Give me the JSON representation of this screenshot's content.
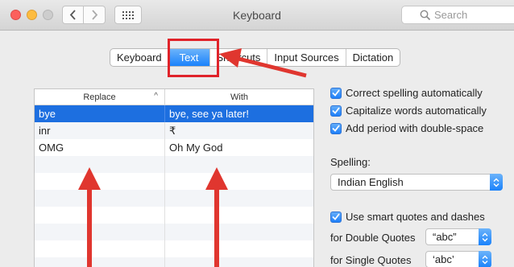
{
  "window": {
    "title": "Keyboard",
    "search_placeholder": "Search"
  },
  "tabs": [
    {
      "label": "Keyboard"
    },
    {
      "label": "Text"
    },
    {
      "label": "Shortcuts"
    },
    {
      "label": "Input Sources"
    },
    {
      "label": "Dictation"
    }
  ],
  "table": {
    "col_replace": "Replace",
    "col_with": "With",
    "rows": [
      {
        "replace": "bye",
        "with": "bye, see ya later!"
      },
      {
        "replace": "inr",
        "with": "₹"
      },
      {
        "replace": "OMG",
        "with": "Oh My God"
      }
    ]
  },
  "options": {
    "correct_spelling": "Correct spelling automatically",
    "capitalize_words": "Capitalize words automatically",
    "add_period": "Add period with double-space",
    "spelling_label": "Spelling:",
    "spelling_value": "Indian English",
    "smart_quotes": "Use smart quotes and dashes",
    "double_quotes_label": "for Double Quotes",
    "double_quotes_value": "“abc”",
    "single_quotes_label": "for Single Quotes",
    "single_quotes_value": "‘abc’"
  },
  "colors": {
    "accent": "#1a82fb",
    "annotation_red": "#e0232a"
  }
}
